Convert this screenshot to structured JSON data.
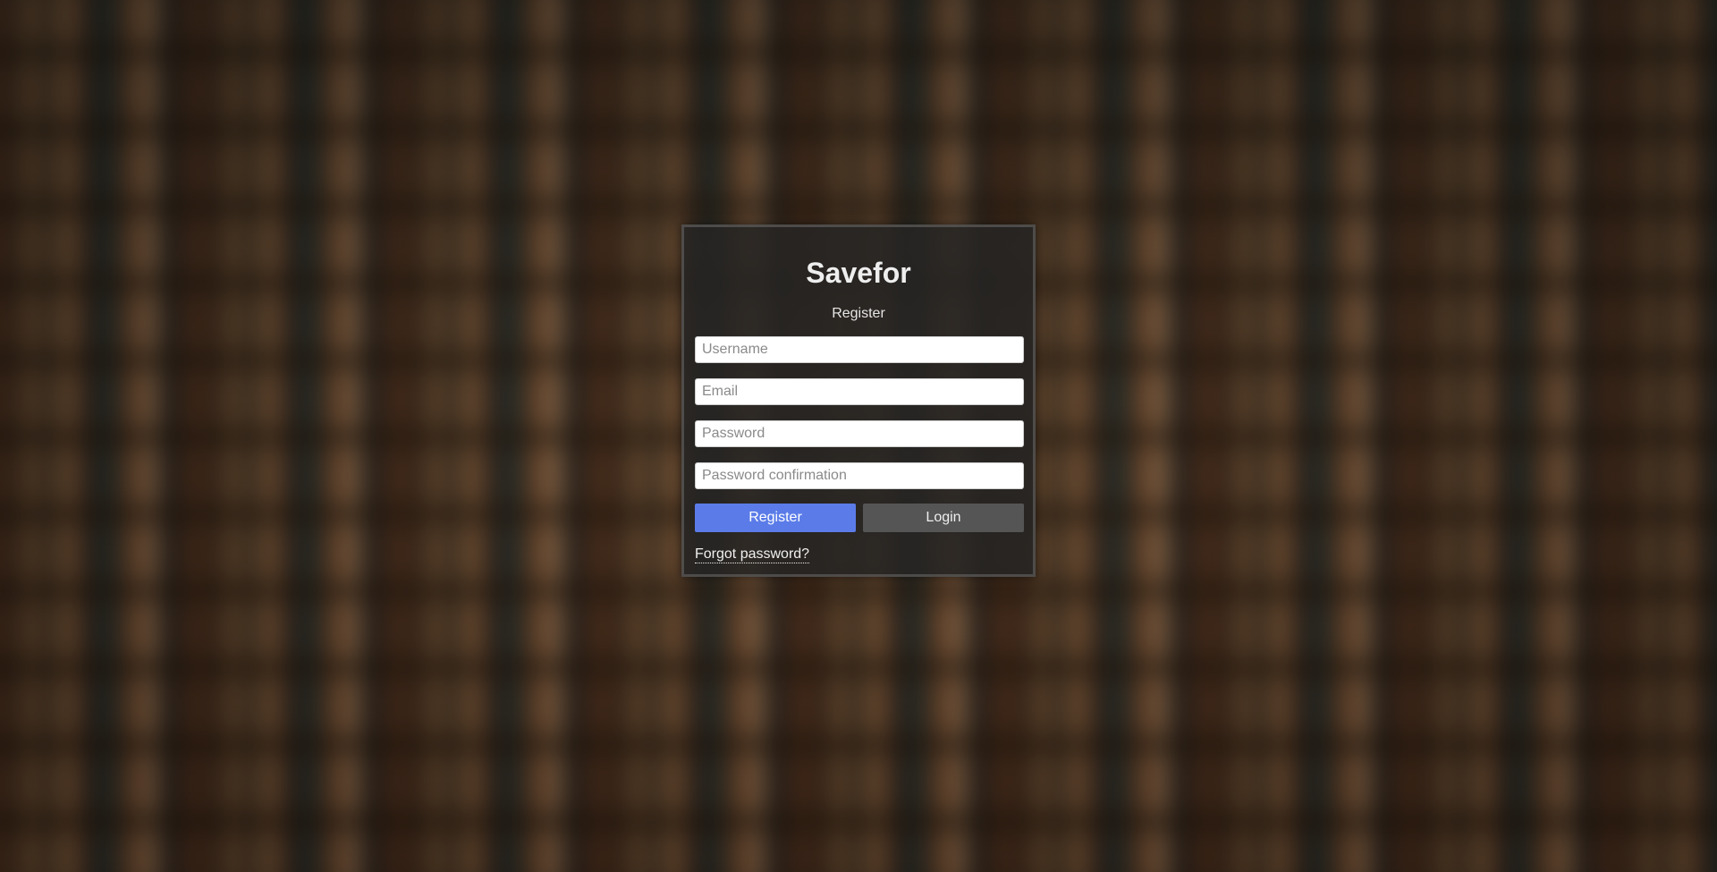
{
  "app": {
    "title": "Savefor",
    "subtitle": "Register"
  },
  "form": {
    "username_placeholder": "Username",
    "email_placeholder": "Email",
    "password_placeholder": "Password",
    "password_confirmation_placeholder": "Password confirmation",
    "register_label": "Register",
    "login_label": "Login",
    "forgot_label": "Forgot password?"
  },
  "colors": {
    "register_button": "#5b7ce8",
    "login_button": "#555555",
    "card_background": "#262423"
  }
}
